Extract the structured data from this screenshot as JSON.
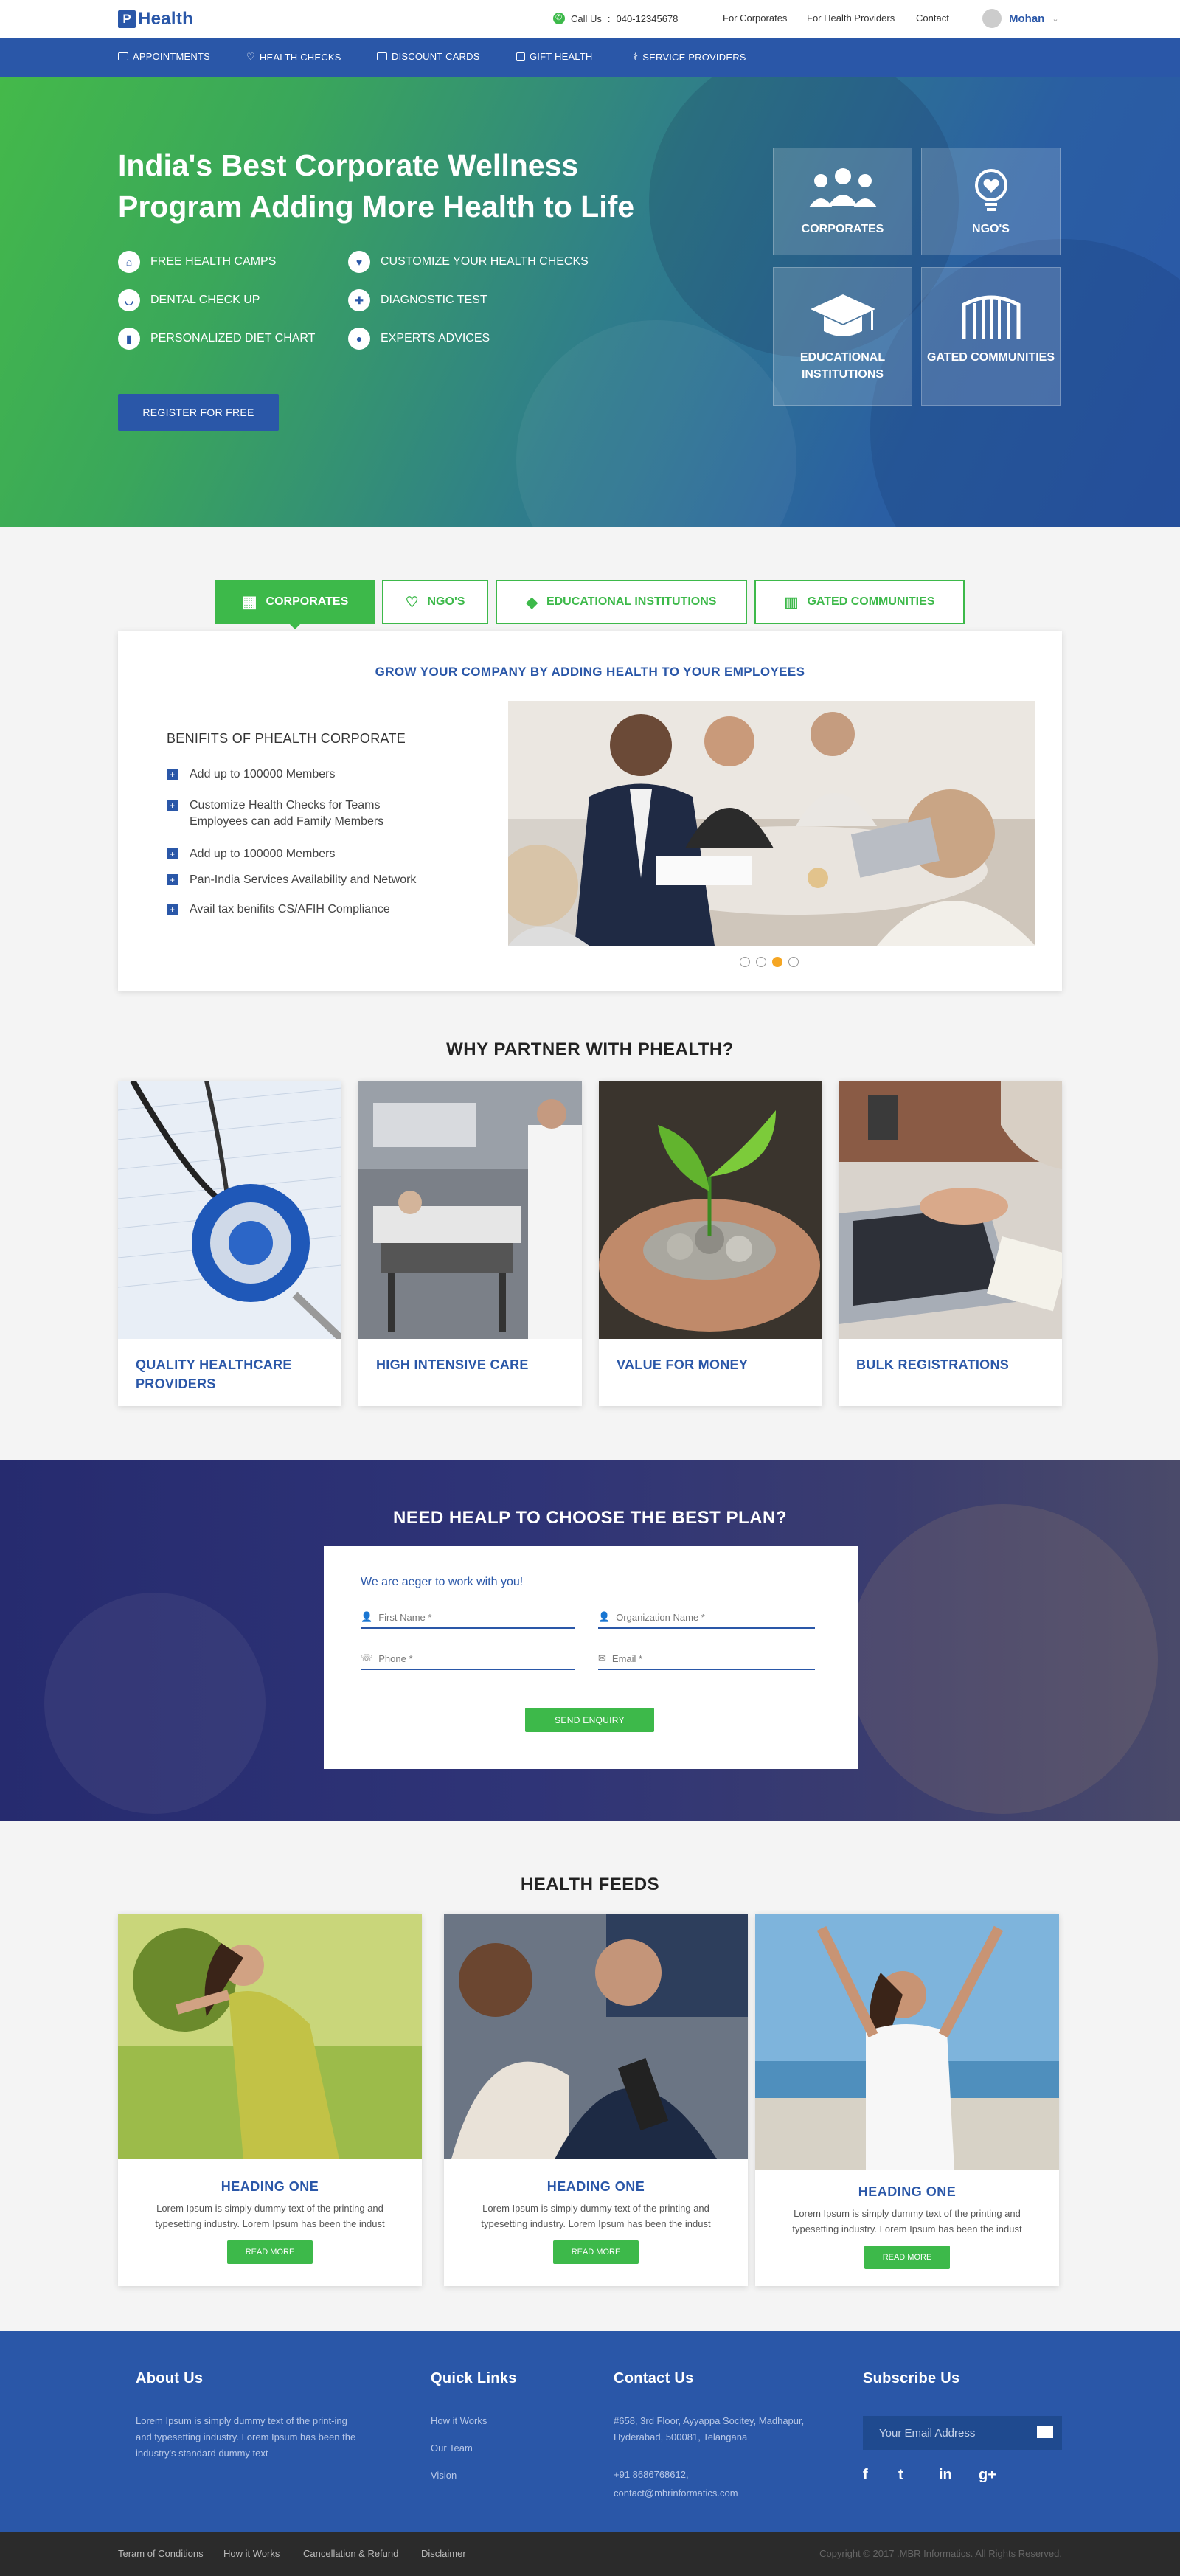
{
  "brand": {
    "logo_letter": "P",
    "name": "Health"
  },
  "topbar": {
    "call_label": "Call Us",
    "call_sep": ":",
    "phone": "040-12345678",
    "links": [
      "For Corporates",
      "For Health Providers",
      "Contact"
    ],
    "user_name": "Mohan"
  },
  "nav": {
    "items": [
      "APPOINTMENTS",
      "HEALTH CHECKS",
      "DISCOUNT CARDS",
      "GIFT HEALTH",
      "SERVICE PROVIDERS"
    ]
  },
  "hero": {
    "title_line1": "India's Best Corporate Wellness",
    "title_line2": "Program Adding More Health to Life",
    "features": [
      "FREE HEALTH CAMPS",
      "CUSTOMIZE YOUR HEALTH CHECKS",
      "DENTAL CHECK UP",
      "DIAGNOSTIC TEST",
      "PERSONALIZED DIET CHART",
      "EXPERTS ADVICES"
    ],
    "register_label": "REGISTER FOR FREE",
    "tiles": [
      "CORPORATES",
      "NGO'S",
      "EDUCATIONAL INSTITUTIONS",
      "GATED COMMUNITIES"
    ]
  },
  "tabs": {
    "items": [
      "CORPORATES",
      "NGO'S",
      "EDUCATIONAL INSTITUTIONS",
      "GATED COMMUNITIES"
    ],
    "active_index": 0
  },
  "corporate_card": {
    "heading": "GROW YOUR COMPANY BY ADDING HEALTH TO YOUR EMPLOYEES",
    "benefits_title": "BENIFITS OF PHEALTH CORPORATE",
    "benefits": [
      "Add up to 100000 Members",
      "Customize Health Checks for Teams Employees can add Family Members",
      "Add up to 100000 Members",
      "Pan-India Services Availability and Network",
      "Avail tax benifits CS/AFIH Compliance"
    ],
    "carousel_active": 3
  },
  "partner": {
    "title": "WHY PARTNER WITH PHEALTH?",
    "cards": [
      "QUALITY HEALTHCARE PROVIDERS",
      "HIGH INTENSIVE CARE",
      "VALUE FOR MONEY",
      "BULK REGISTRATIONS"
    ]
  },
  "enquiry": {
    "title": "NEED HEALP TO CHOOSE THE BEST PLAN?",
    "subtitle": "We are aeger to work with you!",
    "first_name": "First Name *",
    "organization": "Organization Name *",
    "phone": "Phone *",
    "email": "Email *",
    "send_label": "SEND ENQUIRY"
  },
  "feeds": {
    "title": "HEALTH FEEDS",
    "items": [
      {
        "heading": "HEADING ONE",
        "text": "Lorem Ipsum is simply dummy text of the printing and typesetting industry. Lorem Ipsum has been the indust",
        "button": "READ MORE"
      },
      {
        "heading": "HEADING ONE",
        "text": "Lorem Ipsum is simply dummy text of the printing and typesetting industry. Lorem Ipsum has been the indust",
        "button": "READ MORE"
      },
      {
        "heading": "HEADING ONE",
        "text": "Lorem Ipsum is simply dummy text of the printing and typesetting industry. Lorem Ipsum has been the indust",
        "button": "READ MORE"
      }
    ]
  },
  "footer": {
    "about_title": "About Us",
    "about_text": "Lorem Ipsum is simply dummy text of the print-ing and typesetting industry. Lorem Ipsum has been the industry's standard dummy text",
    "quick_title": "Quick Links",
    "quick_links": [
      "How it Works",
      "Our Team",
      "Vision"
    ],
    "contact_title": "Contact Us",
    "address": "#658, 3rd Floor, Ayyappa Socitey, Madhapur, Hyderabad, 500081, Telangana",
    "contact_phone": "+91 8686768612,",
    "contact_email": "contact@mbrinformatics.com",
    "subscribe_title": "Subscribe Us",
    "email_placeholder": "Your Email Address",
    "social": [
      "f",
      "t",
      "in",
      "g+"
    ]
  },
  "bottom": {
    "links": [
      "Teram of Conditions",
      "How it Works",
      "Cancellation & Refund",
      "Disclaimer"
    ],
    "copyright": "Copyright © 2017 .MBR Informatics. All Rights Reserved."
  },
  "colors": {
    "primary": "#2a57a8",
    "accent": "#3db94a",
    "dark": "#2b2b2b",
    "carousel_active": "#f5a623"
  }
}
